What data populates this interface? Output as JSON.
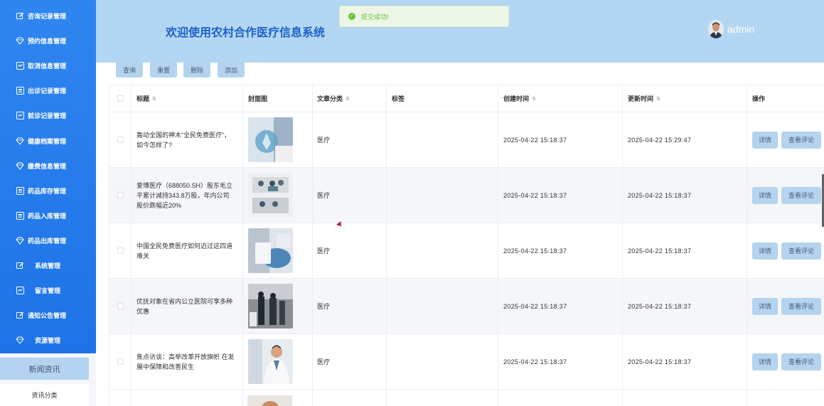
{
  "sidebar": {
    "items": [
      {
        "label": "咨询记录管理",
        "icon": "edit-icon"
      },
      {
        "label": "预约信息管理",
        "icon": "diamond-icon"
      },
      {
        "label": "取消信息管理",
        "icon": "chart-icon"
      },
      {
        "label": "出诊记录管理",
        "icon": "id-card-icon"
      },
      {
        "label": "就诊记录管理",
        "icon": "chart-icon"
      },
      {
        "label": "健康档案管理",
        "icon": "diamond-icon"
      },
      {
        "label": "缴费信息管理",
        "icon": "diamond-icon"
      },
      {
        "label": "药品库存管理",
        "icon": "id-card-icon"
      },
      {
        "label": "药品入库管理",
        "icon": "id-card-icon"
      },
      {
        "label": "药品出库管理",
        "icon": "diamond-icon"
      },
      {
        "label": "系统管理",
        "icon": "edit-icon"
      },
      {
        "label": "留言管理",
        "icon": "chart-icon"
      },
      {
        "label": "通知公告管理",
        "icon": "edit-icon"
      },
      {
        "label": "资源管理",
        "icon": "diamond-icon"
      }
    ],
    "active_group": "新闻资讯",
    "sub_item": "资讯分类"
  },
  "header": {
    "title": "欢迎使用农村合作医疗信息系统",
    "username": "admin"
  },
  "toast": {
    "text": "提交成功!"
  },
  "toolbar": {
    "query": "查询",
    "reset": "重置",
    "delete": "删除",
    "add": "添加"
  },
  "table": {
    "columns": [
      "标题",
      "封面图",
      "文章分类",
      "标签",
      "创建时间",
      "更新时间",
      "操作"
    ],
    "detail_label": "详情",
    "comment_label": "查看评论",
    "rows": [
      {
        "title": "轰动全国的神木“全民免费医疗”，如今怎样了?",
        "category": "医疗",
        "tag": "",
        "created": "2025-04-22 15:18:37",
        "updated": "2025-04-22 15:29:47"
      },
      {
        "title": "爱博医疗（688050.SH）股东毛立平累计减持343.8万股，年内公司股价跌幅近20%",
        "category": "医疗",
        "tag": "",
        "created": "2025-04-22 15:18:37",
        "updated": "2025-04-22 15:18:37"
      },
      {
        "title": "中国全民免费医疗如何迈过这四道难关",
        "category": "医疗",
        "tag": "",
        "created": "2025-04-22 15:18:37",
        "updated": "2025-04-22 15:18:37"
      },
      {
        "title": "优抚对象在省内公立医院可享多种优惠",
        "category": "医疗",
        "tag": "",
        "created": "2025-04-22 15:18:37",
        "updated": "2025-04-22 15:18:37"
      },
      {
        "title": "焦点访谈：高举改革开放旗帜 在发展中保障和改善民生",
        "category": "医疗",
        "tag": "",
        "created": "2025-04-22 15:18:37",
        "updated": "2025-04-22 15:18:37"
      }
    ]
  },
  "colors": {
    "sidebar": "#2f86f0",
    "header": "#b3d6f2",
    "title": "#1e60c8",
    "button": "#b3d3ee",
    "success": "#67c23a"
  }
}
